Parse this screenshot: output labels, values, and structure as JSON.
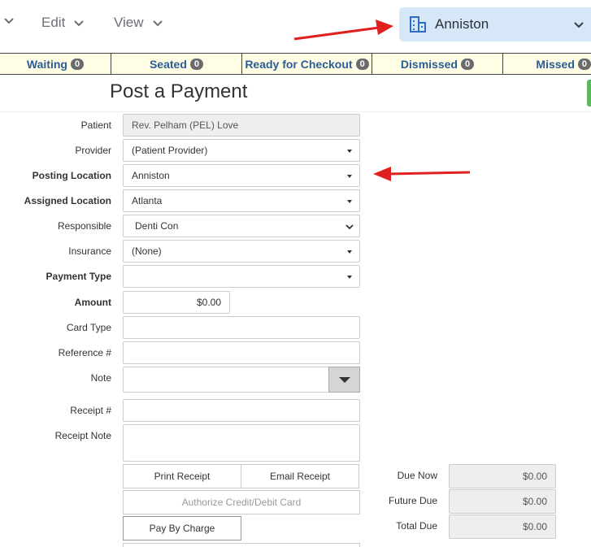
{
  "menu": {
    "edit": "Edit",
    "view": "View"
  },
  "location_selector": {
    "value": "Anniston"
  },
  "status_tabs": [
    {
      "label": "Waiting",
      "count": "0"
    },
    {
      "label": "Seated",
      "count": "0"
    },
    {
      "label": "Ready for Checkout",
      "count": "0"
    },
    {
      "label": "Dismissed",
      "count": "0"
    },
    {
      "label": "Missed",
      "count": "0"
    }
  ],
  "page_title": "Post a Payment",
  "form": {
    "patient": {
      "label": "Patient",
      "value": "Rev. Pelham (PEL) Love"
    },
    "provider": {
      "label": "Provider",
      "value": "(Patient Provider)"
    },
    "posting_location": {
      "label": "Posting Location",
      "value": "Anniston"
    },
    "assigned_location": {
      "label": "Assigned Location",
      "value": "Atlanta"
    },
    "responsible": {
      "label": "Responsible",
      "value": "Denti Con"
    },
    "insurance": {
      "label": "Insurance",
      "value": "(None)"
    },
    "payment_type": {
      "label": "Payment Type",
      "value": ""
    },
    "amount": {
      "label": "Amount",
      "value": "$0.00"
    },
    "card_type": {
      "label": "Card Type",
      "value": ""
    },
    "reference": {
      "label": "Reference #",
      "value": ""
    },
    "note": {
      "label": "Note",
      "value": ""
    },
    "receipt_no": {
      "label": "Receipt #",
      "value": ""
    },
    "receipt_note": {
      "label": "Receipt Note",
      "value": ""
    }
  },
  "buttons": {
    "print_receipt": "Print Receipt",
    "email_receipt": "Email Receipt",
    "authorize_card": "Authorize Credit/Debit Card",
    "pay_by_charge": "Pay By Charge"
  },
  "dues": {
    "due_now": {
      "label": "Due Now",
      "value": "$0.00"
    },
    "future_due": {
      "label": "Future Due",
      "value": "$0.00"
    },
    "total_due": {
      "label": "Total Due",
      "value": "$0.00"
    }
  },
  "colors": {
    "accent": "#2a5d96",
    "arrow": "#e01f1f",
    "location_bg": "#d6e7f8",
    "status_bg": "#fffde4"
  }
}
